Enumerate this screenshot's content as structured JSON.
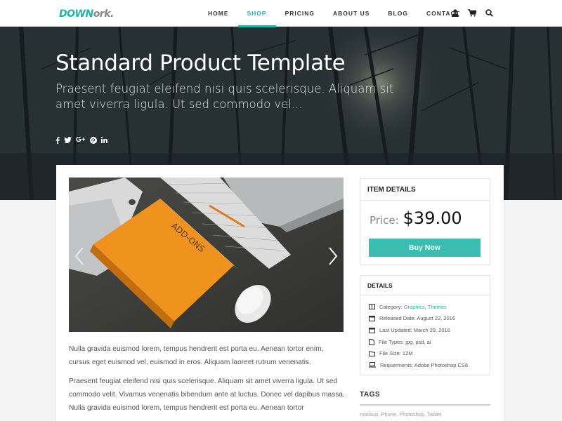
{
  "brand": {
    "logo_part1": "DOWN",
    "logo_part2": "ork."
  },
  "nav": {
    "items": [
      {
        "label": "HOME",
        "active": false
      },
      {
        "label": "SHOP",
        "active": true
      },
      {
        "label": "PRICING",
        "active": false
      },
      {
        "label": "ABOUT US",
        "active": false
      },
      {
        "label": "BLOG",
        "active": false
      },
      {
        "label": "CONTACT",
        "active": false
      }
    ],
    "icons": [
      "user-icon",
      "cart-icon",
      "search-icon"
    ]
  },
  "hero": {
    "title": "Standard Product Template",
    "subtitle": "Praesent feugiat eleifend nisi quis scelerisque. Aliquam sit amet viverra ligula. Ut sed commodo vel...",
    "social_icons": [
      "facebook-icon",
      "twitter-icon",
      "google-plus-icon",
      "pinterest-icon",
      "linkedin-icon"
    ]
  },
  "product": {
    "description": [
      "Nulla gravida euismod lorem, tempus hendrerit est porta eu. Aenean tortor enim, cursus eget euismod vel, euismod in eros. Aliquam laoreet rutrum venenatis.",
      "Praesent feugiat eleifend nisi quis scelerisque. Aliquam sit amet viverra ligula. Ut sed commodo velit. Vivamus venenatis bibendum ante at luctus. Donec vel dapibus massa. Nulla gravida euismod lorem, tempus hendrerit est porta eu. Aenean tortor"
    ],
    "book_label": "ADD-ONS"
  },
  "item_details": {
    "title": "ITEM DETAILS",
    "price_label": "Price:",
    "price": "$39.00",
    "buy_label": "Buy Now"
  },
  "details": {
    "title": "DETAILS",
    "category_label": "Category:",
    "category_1": "Graphics",
    "category_sep": ",",
    "category_2": "Themes",
    "released": "Released Date: August 22, 2016",
    "updated": "Last Updated: March 29, 2016",
    "file_types": "File Types: jpg, psd, ai",
    "file_size": "File Size: 12M",
    "requirements": "Requerments: Adobe Photoshop CS6"
  },
  "tags": {
    "title": "TAGS",
    "list": "mockup, Phone, Photoshop, Tablet"
  },
  "colors": {
    "accent": "#1fb5a8",
    "button": "#3bbdb1"
  }
}
